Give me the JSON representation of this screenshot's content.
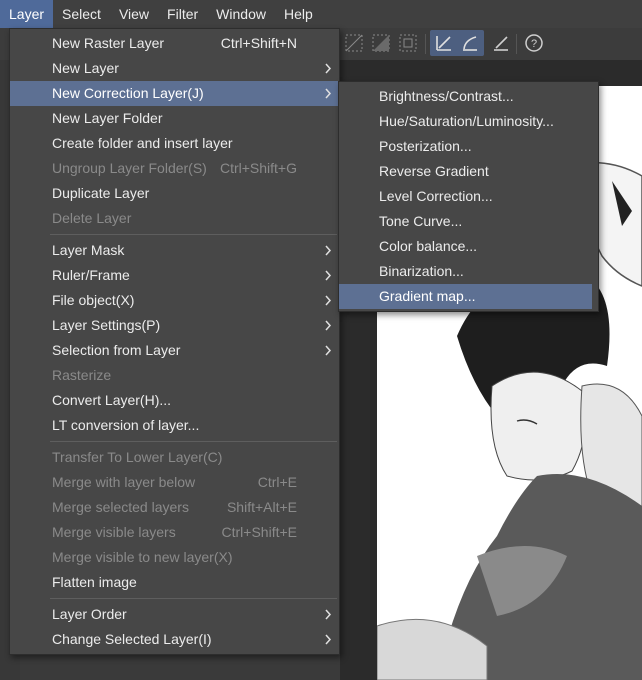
{
  "menubar": {
    "items": [
      {
        "label": "Layer",
        "active": true
      },
      {
        "label": "Select"
      },
      {
        "label": "View"
      },
      {
        "label": "Filter"
      },
      {
        "label": "Window"
      },
      {
        "label": "Help"
      }
    ]
  },
  "layer_menu": {
    "items": [
      {
        "label": "New Raster Layer",
        "shortcut": "Ctrl+Shift+N"
      },
      {
        "label": "New Layer",
        "submenu": true
      },
      {
        "label": "New Correction Layer(J)",
        "submenu": true,
        "highlight": true
      },
      {
        "label": "New Layer Folder"
      },
      {
        "label": "Create folder and insert layer"
      },
      {
        "label": "Ungroup Layer Folder(S)",
        "shortcut": "Ctrl+Shift+G",
        "disabled": true
      },
      {
        "label": "Duplicate Layer"
      },
      {
        "label": "Delete Layer",
        "disabled": true
      },
      {
        "separator": true
      },
      {
        "label": "Layer Mask",
        "submenu": true
      },
      {
        "label": "Ruler/Frame",
        "submenu": true
      },
      {
        "label": "File object(X)",
        "submenu": true
      },
      {
        "label": "Layer Settings(P)",
        "submenu": true
      },
      {
        "label": "Selection from Layer",
        "submenu": true
      },
      {
        "label": "Rasterize",
        "disabled": true
      },
      {
        "label": "Convert Layer(H)..."
      },
      {
        "label": "LT conversion of layer..."
      },
      {
        "separator": true
      },
      {
        "label": "Transfer To Lower Layer(C)",
        "disabled": true
      },
      {
        "label": "Merge with layer below",
        "shortcut": "Ctrl+E",
        "disabled": true
      },
      {
        "label": "Merge selected layers",
        "shortcut": "Shift+Alt+E",
        "disabled": true
      },
      {
        "label": "Merge visible layers",
        "shortcut": "Ctrl+Shift+E",
        "disabled": true
      },
      {
        "label": "Merge visible to new layer(X)",
        "disabled": true
      },
      {
        "label": "Flatten image"
      },
      {
        "separator": true
      },
      {
        "label": "Layer Order",
        "submenu": true
      },
      {
        "label": "Change Selected Layer(I)",
        "submenu": true
      }
    ]
  },
  "correction_submenu": {
    "items": [
      {
        "label": "Brightness/Contrast..."
      },
      {
        "label": "Hue/Saturation/Luminosity..."
      },
      {
        "label": "Posterization..."
      },
      {
        "label": "Reverse Gradient"
      },
      {
        "label": "Level Correction..."
      },
      {
        "label": "Tone Curve..."
      },
      {
        "label": "Color balance..."
      },
      {
        "label": "Binarization..."
      },
      {
        "label": "Gradient map...",
        "highlight": true
      }
    ]
  },
  "toolbar": {
    "icons": [
      "selection-icon",
      "selection-icon",
      "selection-icon",
      "ruler-snap-icon",
      "ruler-snap-icon",
      "ruler-snap-icon",
      "help-icon"
    ]
  },
  "colors": {
    "menu_bg": "#474747",
    "highlight": "#5d7093",
    "disabled_text": "#8a8a8a"
  }
}
